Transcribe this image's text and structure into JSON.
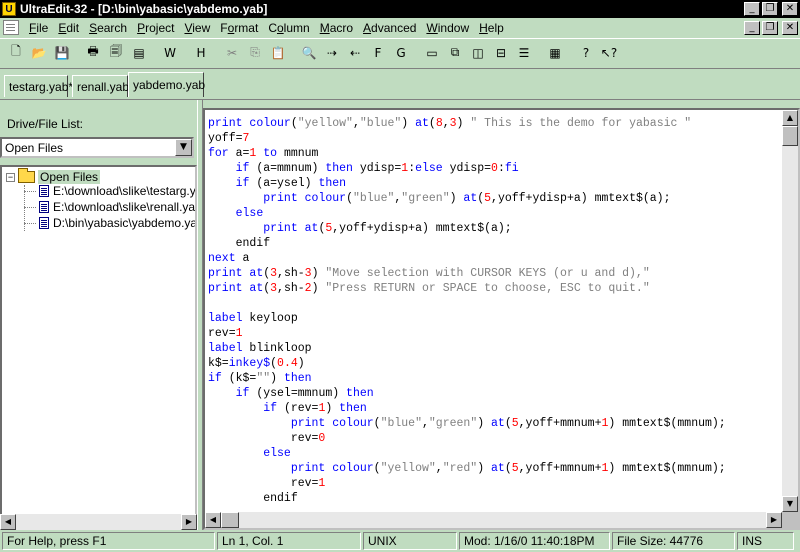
{
  "window": {
    "title": "UltraEdit-32 - [D:\\bin\\yabasic\\yabdemo.yab]",
    "app_icon": "U",
    "controls": [
      "_",
      "❐",
      "✕"
    ]
  },
  "menu": {
    "items": [
      {
        "ul": "F",
        "rest": "ile"
      },
      {
        "ul": "E",
        "rest": "dit"
      },
      {
        "ul": "S",
        "rest": "earch"
      },
      {
        "ul": "P",
        "rest": "roject"
      },
      {
        "ul": "V",
        "rest": "iew"
      },
      {
        "pre": "F",
        "ul": "o",
        "rest": "rmat"
      },
      {
        "pre": "C",
        "ul": "o",
        "rest": "lumn"
      },
      {
        "ul": "M",
        "rest": "acro"
      },
      {
        "ul": "A",
        "rest": "dvanced"
      },
      {
        "ul": "W",
        "rest": "indow"
      },
      {
        "ul": "H",
        "rest": "elp"
      }
    ],
    "doc_controls": [
      "_",
      "❐",
      "✕"
    ]
  },
  "toolbar": {
    "buttons": [
      {
        "name": "new-file",
        "glyph": "🗋",
        "dim": false
      },
      {
        "name": "open-file",
        "glyph": "📂",
        "dim": false
      },
      {
        "name": "save",
        "glyph": "💾",
        "dim": true
      },
      {
        "sep": true
      },
      {
        "name": "print",
        "glyph": "🖶",
        "dim": false
      },
      {
        "name": "print-preview",
        "glyph": "🗐",
        "dim": false
      },
      {
        "name": "print-setup",
        "glyph": "▤",
        "dim": false
      },
      {
        "sep": true
      },
      {
        "name": "word-wrap",
        "glyph": "W",
        "dim": false
      },
      {
        "sep": true
      },
      {
        "name": "hex-edit",
        "glyph": "H",
        "dim": false
      },
      {
        "sep": true
      },
      {
        "name": "cut",
        "glyph": "✂",
        "dim": true
      },
      {
        "name": "copy",
        "glyph": "⎘",
        "dim": true
      },
      {
        "name": "paste",
        "glyph": "📋",
        "dim": false
      },
      {
        "sep": true
      },
      {
        "name": "find",
        "glyph": "🔍",
        "dim": false
      },
      {
        "name": "find-next",
        "glyph": "⇢",
        "dim": false
      },
      {
        "name": "find-prev",
        "glyph": "⇠",
        "dim": false
      },
      {
        "name": "find-in-files",
        "glyph": "F",
        "dim": false
      },
      {
        "name": "goto",
        "glyph": "G",
        "dim": false
      },
      {
        "sep": true
      },
      {
        "name": "window-list",
        "glyph": "▭",
        "dim": false
      },
      {
        "name": "cascade",
        "glyph": "⧉",
        "dim": false
      },
      {
        "name": "tile-vertical",
        "glyph": "◫",
        "dim": false
      },
      {
        "name": "tile-horizontal",
        "glyph": "⊟",
        "dim": false
      },
      {
        "name": "arrange",
        "glyph": "☰",
        "dim": false
      },
      {
        "sep": true
      },
      {
        "name": "ascii-table",
        "glyph": "▦",
        "dim": false
      },
      {
        "sep": true
      },
      {
        "name": "help",
        "glyph": "?",
        "dim": false
      },
      {
        "name": "context-help",
        "glyph": "↖?",
        "dim": false
      }
    ]
  },
  "tabs": [
    "testarg.yab*",
    "renall.yab",
    "yabdemo.yab"
  ],
  "active_tab": 2,
  "left_pane": {
    "label": "Drive/File List:",
    "dropdown_value": "Open Files",
    "tree_root": "Open Files",
    "tree_items": [
      "E:\\download\\slike\\testarg.yab",
      "E:\\download\\slike\\renall.yab",
      "D:\\bin\\yabasic\\yabdemo.yab"
    ]
  },
  "editor": {
    "lines": [
      [
        [
          "k",
          "print "
        ],
        [
          "k",
          "colour"
        ],
        [
          "t",
          "("
        ],
        [
          "s",
          "\"yellow\""
        ],
        [
          "t",
          ","
        ],
        [
          "s",
          "\"blue\""
        ],
        [
          "t",
          ") "
        ],
        [
          "k",
          "at"
        ],
        [
          "t",
          "("
        ],
        [
          "n",
          "8"
        ],
        [
          "t",
          ","
        ],
        [
          "n",
          "3"
        ],
        [
          "t",
          ") "
        ],
        [
          "s",
          "\" This is the demo for yabasic \""
        ]
      ],
      [
        [
          "t",
          "yoff="
        ],
        [
          "n",
          "7"
        ]
      ],
      [
        [
          "k",
          "for "
        ],
        [
          "t",
          "a="
        ],
        [
          "n",
          "1"
        ],
        [
          "k",
          " to "
        ],
        [
          "t",
          "mmnum"
        ]
      ],
      [
        [
          "t",
          "    "
        ],
        [
          "k",
          "if "
        ],
        [
          "t",
          "(a=mmnum) "
        ],
        [
          "k",
          "then "
        ],
        [
          "t",
          "ydisp="
        ],
        [
          "n",
          "1"
        ],
        [
          "t",
          ":"
        ],
        [
          "k",
          "else "
        ],
        [
          "t",
          "ydisp="
        ],
        [
          "n",
          "0"
        ],
        [
          "t",
          ":"
        ],
        [
          "k",
          "fi"
        ]
      ],
      [
        [
          "t",
          "    "
        ],
        [
          "k",
          "if "
        ],
        [
          "t",
          "(a=ysel) "
        ],
        [
          "k",
          "then"
        ]
      ],
      [
        [
          "t",
          "        "
        ],
        [
          "k",
          "print "
        ],
        [
          "k",
          "colour"
        ],
        [
          "t",
          "("
        ],
        [
          "s",
          "\"blue\""
        ],
        [
          "t",
          ","
        ],
        [
          "s",
          "\"green\""
        ],
        [
          "t",
          ") "
        ],
        [
          "k",
          "at"
        ],
        [
          "t",
          "("
        ],
        [
          "n",
          "5"
        ],
        [
          "t",
          ",yoff+ydisp+a) mmtext$(a);"
        ]
      ],
      [
        [
          "t",
          "    "
        ],
        [
          "k",
          "else"
        ]
      ],
      [
        [
          "t",
          "        "
        ],
        [
          "k",
          "print "
        ],
        [
          "k",
          "at"
        ],
        [
          "t",
          "("
        ],
        [
          "n",
          "5"
        ],
        [
          "t",
          ",yoff+ydisp+a) mmtext$(a);"
        ]
      ],
      [
        [
          "t",
          "    endif"
        ]
      ],
      [
        [
          "k",
          "next "
        ],
        [
          "t",
          "a"
        ]
      ],
      [
        [
          "k",
          "print "
        ],
        [
          "k",
          "at"
        ],
        [
          "t",
          "("
        ],
        [
          "n",
          "3"
        ],
        [
          "t",
          ",sh-"
        ],
        [
          "n",
          "3"
        ],
        [
          "t",
          ") "
        ],
        [
          "s",
          "\"Move selection with CURSOR KEYS (or u and d),\""
        ]
      ],
      [
        [
          "k",
          "print "
        ],
        [
          "k",
          "at"
        ],
        [
          "t",
          "("
        ],
        [
          "n",
          "3"
        ],
        [
          "t",
          ",sh-"
        ],
        [
          "n",
          "2"
        ],
        [
          "t",
          ") "
        ],
        [
          "s",
          "\"Press RETURN or SPACE to choose, ESC to quit.\""
        ]
      ],
      [
        [
          "t",
          ""
        ]
      ],
      [
        [
          "k",
          "label "
        ],
        [
          "t",
          "keyloop"
        ]
      ],
      [
        [
          "t",
          "rev="
        ],
        [
          "n",
          "1"
        ]
      ],
      [
        [
          "k",
          "label "
        ],
        [
          "t",
          "blinkloop"
        ]
      ],
      [
        [
          "t",
          "k$="
        ],
        [
          "k",
          "inkey$"
        ],
        [
          "t",
          "("
        ],
        [
          "n",
          "0.4"
        ],
        [
          "t",
          ")"
        ]
      ],
      [
        [
          "k",
          "if "
        ],
        [
          "t",
          "(k$="
        ],
        [
          "s",
          "\"\""
        ],
        [
          "t",
          ") "
        ],
        [
          "k",
          "then"
        ]
      ],
      [
        [
          "t",
          "    "
        ],
        [
          "k",
          "if "
        ],
        [
          "t",
          "(ysel=mmnum) "
        ],
        [
          "k",
          "then"
        ]
      ],
      [
        [
          "t",
          "        "
        ],
        [
          "k",
          "if "
        ],
        [
          "t",
          "(rev="
        ],
        [
          "n",
          "1"
        ],
        [
          "t",
          ") "
        ],
        [
          "k",
          "then"
        ]
      ],
      [
        [
          "t",
          "            "
        ],
        [
          "k",
          "print "
        ],
        [
          "k",
          "colour"
        ],
        [
          "t",
          "("
        ],
        [
          "s",
          "\"blue\""
        ],
        [
          "t",
          ","
        ],
        [
          "s",
          "\"green\""
        ],
        [
          "t",
          ") "
        ],
        [
          "k",
          "at"
        ],
        [
          "t",
          "("
        ],
        [
          "n",
          "5"
        ],
        [
          "t",
          ",yoff+mmnum+"
        ],
        [
          "n",
          "1"
        ],
        [
          "t",
          ") mmtext$(mmnum);"
        ]
      ],
      [
        [
          "t",
          "            rev="
        ],
        [
          "n",
          "0"
        ]
      ],
      [
        [
          "t",
          "        "
        ],
        [
          "k",
          "else"
        ]
      ],
      [
        [
          "t",
          "            "
        ],
        [
          "k",
          "print "
        ],
        [
          "k",
          "colour"
        ],
        [
          "t",
          "("
        ],
        [
          "s",
          "\"yellow\""
        ],
        [
          "t",
          ","
        ],
        [
          "s",
          "\"red\""
        ],
        [
          "t",
          ") "
        ],
        [
          "k",
          "at"
        ],
        [
          "t",
          "("
        ],
        [
          "n",
          "5"
        ],
        [
          "t",
          ",yoff+mmnum+"
        ],
        [
          "n",
          "1"
        ],
        [
          "t",
          ") mmtext$(mmnum);"
        ]
      ],
      [
        [
          "t",
          "            rev="
        ],
        [
          "n",
          "1"
        ]
      ],
      [
        [
          "t",
          "        endif"
        ]
      ]
    ]
  },
  "status": {
    "help": "For Help, press F1",
    "position": "Ln 1, Col. 1",
    "format": "UNIX",
    "modified": "Mod: 1/16/0 11:40:18PM",
    "file_size": "File Size: 44776",
    "mode": "INS"
  },
  "colors": {
    "background": "#c0dcc0",
    "keyword": "#0000ff",
    "string": "#808080",
    "number": "#ff0000"
  }
}
